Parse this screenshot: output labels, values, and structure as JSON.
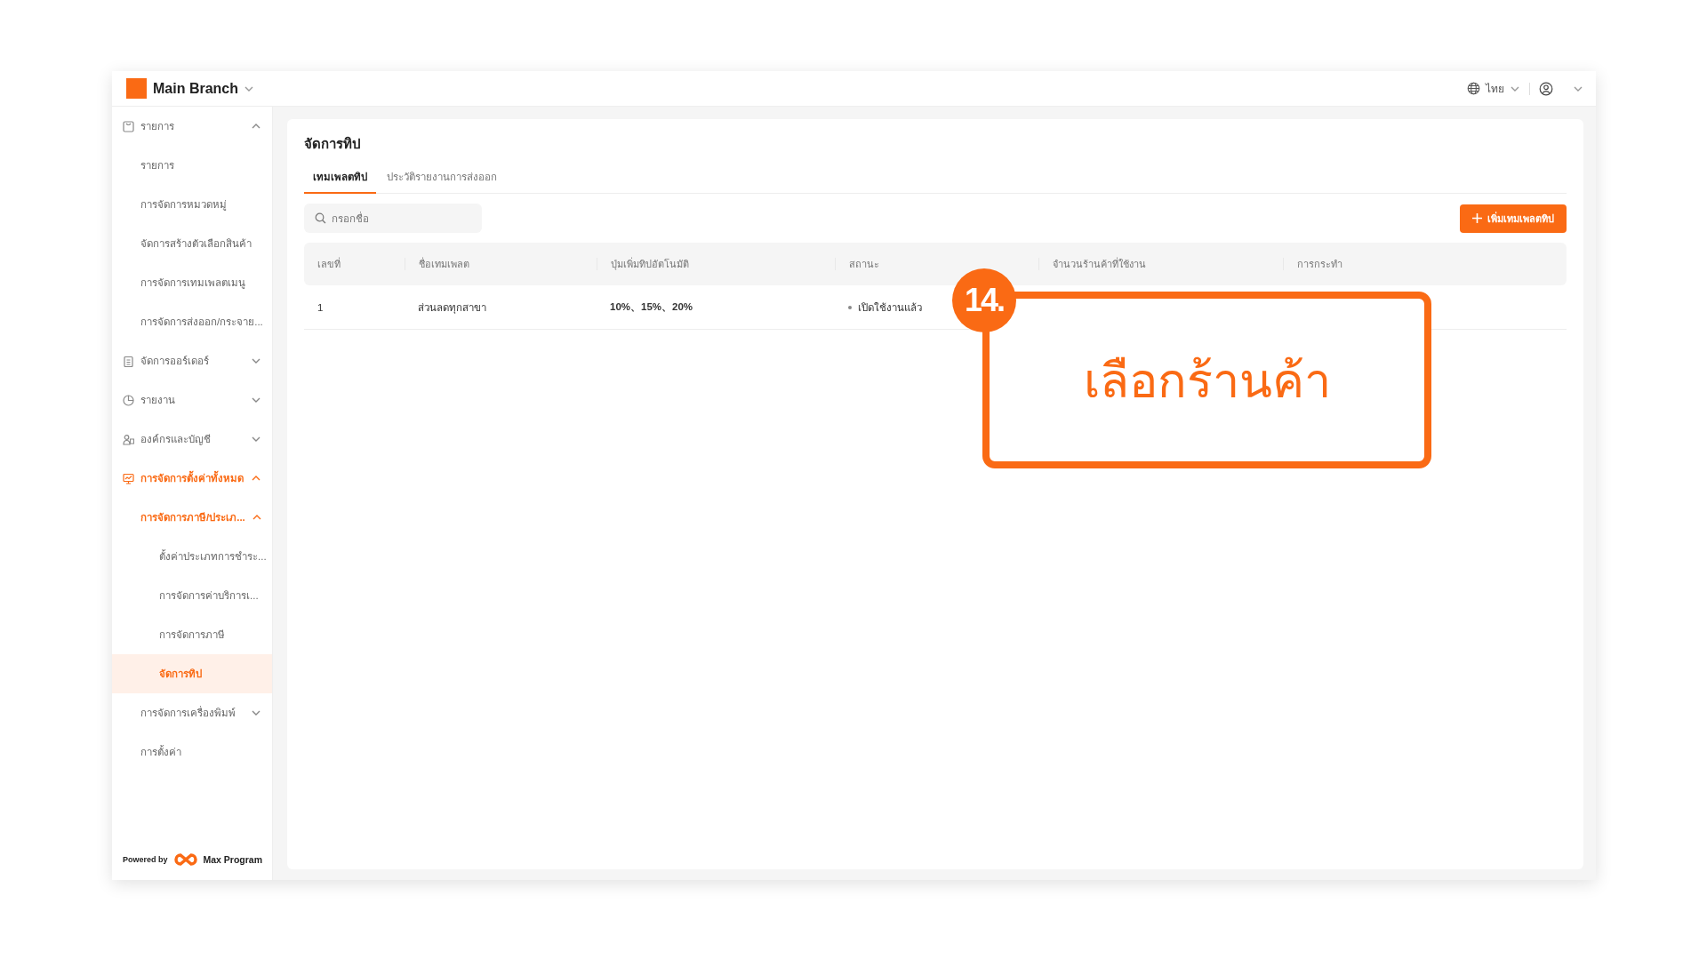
{
  "header": {
    "branch": "Main Branch",
    "language": "ไทย"
  },
  "sidebar": {
    "items": [
      {
        "label": "รายการ",
        "selected": false,
        "expanded": true,
        "children": [
          {
            "label": "รายการ",
            "selected": false
          },
          {
            "label": "การจัดการหมวดหมู่",
            "selected": false
          },
          {
            "label": "จัดการสร้างตัวเลือกสินค้า",
            "selected": false
          },
          {
            "label": "การจัดการเทมเพลตเมนู",
            "selected": false
          },
          {
            "label": "การจัดการส่งออก/กระจาย...",
            "selected": false
          }
        ]
      },
      {
        "label": "จัดการออร์เดอร์",
        "selected": false,
        "expanded": false
      },
      {
        "label": "รายงาน",
        "selected": false,
        "expanded": false
      },
      {
        "label": "องค์กรและบัญชี",
        "selected": false,
        "expanded": false
      },
      {
        "label": "การจัดการตั้งค่าทั้งหมด",
        "selected": false,
        "expanded": true,
        "children": [
          {
            "label": "การจัดการภาษี/ประเภ...",
            "selected": false,
            "expanded": true,
            "children": [
              {
                "label": "ตั้งค่าประเภทการชำระ...",
                "selected": false
              },
              {
                "label": "การจัดการค่าบริการเ...",
                "selected": false
              },
              {
                "label": "การจัดการภาษี",
                "selected": false
              },
              {
                "label": "จัดการทิป",
                "selected": true
              }
            ]
          },
          {
            "label": "การจัดการเครื่องพิมพ์",
            "selected": false,
            "expanded": false
          },
          {
            "label": "การตั้งค่า",
            "selected": false
          }
        ]
      }
    ],
    "footer": {
      "powered_by": "Powered by",
      "brand": "Max Program"
    }
  },
  "page": {
    "title": "จัดการทิป",
    "tabs": [
      {
        "label": "เทมเพลตทิป",
        "selected": true
      },
      {
        "label": "ประวัติรายงานการส่งออก",
        "selected": false
      }
    ],
    "search": {
      "placeholder": "กรอกชื่อ"
    },
    "add_button": "เพิ่มเทมเพลตทิป",
    "table": {
      "columns": [
        "เลขที่",
        "ชื่อเทมเพลต",
        "ปุ่มเพิ่มทิปอัตโนมัติ",
        "สถานะ",
        "จำนวนร้านค้าที่ใช้งาน",
        "การกระทำ"
      ],
      "rows": [
        {
          "number": "1",
          "name": "ส่วนลดทุกสาขา",
          "tips": "10%、15%、20%",
          "status": "เปิดใช้งานแล้ว"
        }
      ]
    }
  },
  "callout": {
    "step": "14.",
    "text": "เลือกร้านค้า"
  }
}
